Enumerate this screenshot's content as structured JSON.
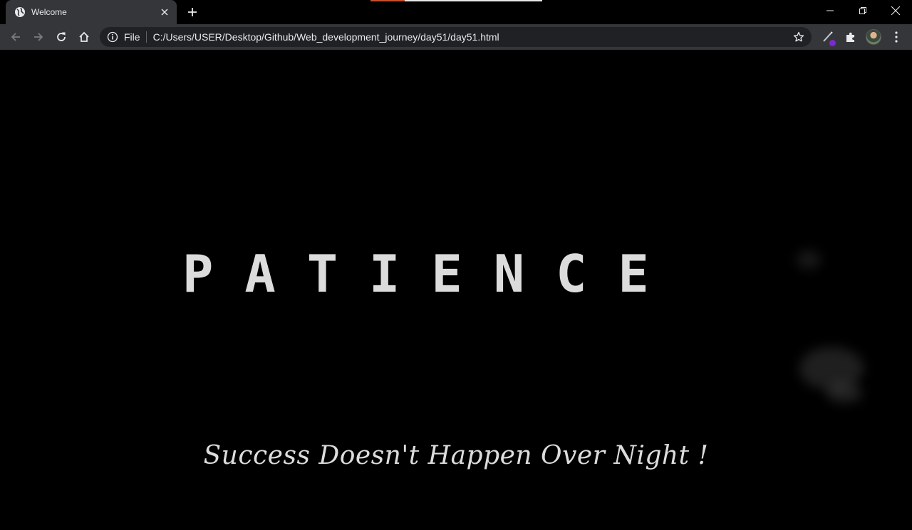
{
  "browser": {
    "tab": {
      "title": "Welcome",
      "favicon": "globe-icon"
    },
    "toolbar": {
      "omnibox_chip": "File",
      "url": "C:/Users/USER/Desktop/Github/Web_development_journey/day51/day51.html"
    },
    "colors": {
      "tabstrip": "#000000",
      "toolbar": "#35363a",
      "omnibox": "#202124",
      "text": "#e8eaed"
    }
  },
  "page": {
    "headline": "PATIENCE",
    "tagline": "Success Doesn't Happen Over Night !",
    "colors": {
      "background": "#000000",
      "text": "#dcdcdc"
    }
  }
}
